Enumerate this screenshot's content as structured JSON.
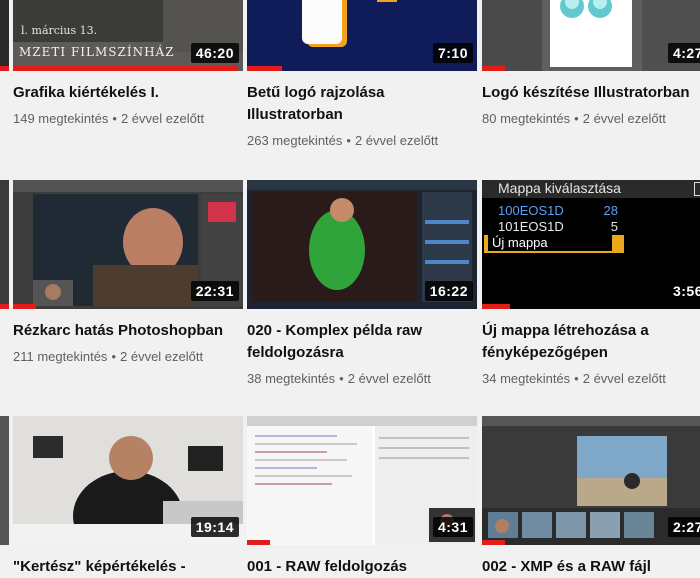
{
  "videos": [
    {
      "title": "Grafika kiértékelés I.",
      "views": "149 megtekintés",
      "age": "2 évvel ezelőtt",
      "duration": "46:20",
      "watched": 0.98,
      "thumb_text_1": "l. március 13.",
      "thumb_text_2": "MZETI FILMSZÍNHÁZ"
    },
    {
      "title": "Betű logó rajzolása Illustratorban",
      "views": "263 megtekintés",
      "age": "2 évvel ezelőtt",
      "duration": "7:10",
      "watched": 0.15
    },
    {
      "title": "Logó készítése Illustratorban",
      "views": "80 megtekintés",
      "age": "2 évvel ezelőtt",
      "duration": "4:27",
      "watched": 0.1
    },
    {
      "title": "Rézkarc hatás Photoshopban",
      "views": "211 megtekintés",
      "age": "2 évvel ezelőtt",
      "duration": "22:31",
      "watched": 0.1
    },
    {
      "title": "020 - Komplex példa raw feldolgozásra",
      "views": "38 megtekintés",
      "age": "2 évvel ezelőtt",
      "duration": "16:22",
      "watched": 0.0
    },
    {
      "title": "Új mappa létrehozása a fényképezőgépen",
      "views": "34 megtekintés",
      "age": "2 évvel ezelőtt",
      "duration": "3:56",
      "watched": 0.12,
      "menu_title": "Mappa kiválasztása",
      "menu_rows": [
        {
          "name": "100EOS1D",
          "count": "28"
        },
        {
          "name": "101EOS1D",
          "count": "5"
        },
        {
          "name": "Új mappa",
          "count": ""
        }
      ]
    },
    {
      "title": "\"Kertész\" képértékelés -",
      "views": "",
      "age": "",
      "duration": "19:14",
      "watched": 0.0
    },
    {
      "title": "001 - RAW feldolgozás",
      "views": "",
      "age": "",
      "duration": "4:31",
      "watched": 0.1
    },
    {
      "title": "002 - XMP és a RAW fájl",
      "views": "",
      "age": "",
      "duration": "2:27",
      "watched": 0.1
    }
  ],
  "separator": "•",
  "colors": {
    "progress": "#e21b1b",
    "meta": "#606060",
    "title": "#111111",
    "background": "#f1f1f1"
  }
}
